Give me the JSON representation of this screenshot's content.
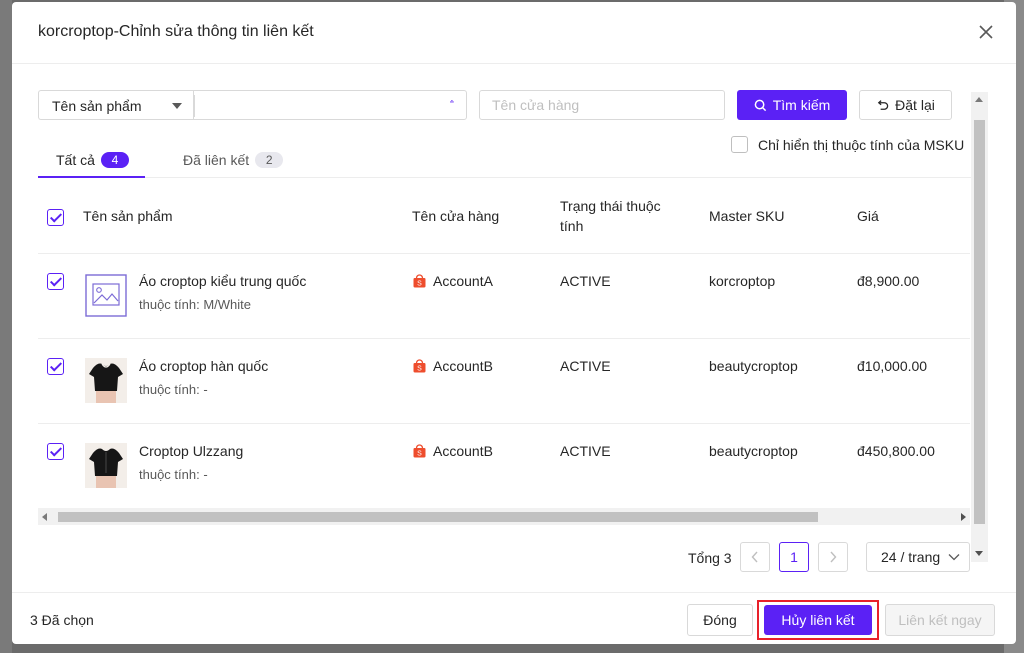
{
  "modal": {
    "title": "korcroptop-Chỉnh sửa thông tin liên kết"
  },
  "search": {
    "field_select": "Tên sản phẩm",
    "name_value": "",
    "shop_placeholder": "Tên cửa hàng",
    "search_label": "Tìm kiếm",
    "reset_label": "Đặt lại"
  },
  "tabs": [
    {
      "label": "Tất cả",
      "count": "4",
      "active": true
    },
    {
      "label": "Đã liên kết",
      "count": "2",
      "active": false
    }
  ],
  "msku_filter_label": "Chỉ hiển thị thuộc tính của MSKU",
  "table": {
    "headers": {
      "product": "Tên sản phẩm",
      "shop": "Tên cửa hàng",
      "status": "Trạng thái thuộc tính",
      "master_sku": "Master SKU",
      "price": "Giá"
    },
    "rows": [
      {
        "name": "Áo croptop kiểu trung quốc",
        "attr": "thuộc tính: M/White",
        "shop": "AccountA",
        "status": "ACTIVE",
        "sku": "korcroptop",
        "price": "đ8,900.00",
        "image": "placeholder-image-icon",
        "checked": true
      },
      {
        "name": "Áo croptop hàn quốc",
        "attr": "thuộc tính: -",
        "shop": "AccountB",
        "status": "ACTIVE",
        "sku": "beautycroptop",
        "price": "đ10,000.00",
        "image": "product-photo",
        "checked": true
      },
      {
        "name": "Croptop Ulzzang",
        "attr": "thuộc tính: -",
        "shop": "AccountB",
        "status": "ACTIVE",
        "sku": "beautycroptop",
        "price": "đ450,800.00",
        "image": "product-photo",
        "checked": true
      }
    ]
  },
  "pagination": {
    "total_label": "Tổng 3",
    "current_page": "1",
    "page_size": "24 / trang"
  },
  "footer": {
    "selected_label": "3 Đã chọn",
    "close_label": "Đóng",
    "unlink_label": "Hủy liên kết",
    "link_now_label": "Liên kết ngay"
  },
  "colors": {
    "primary": "#5b21f5",
    "highlight": "#e8212b",
    "shop_icon": "#ee4d2d"
  }
}
